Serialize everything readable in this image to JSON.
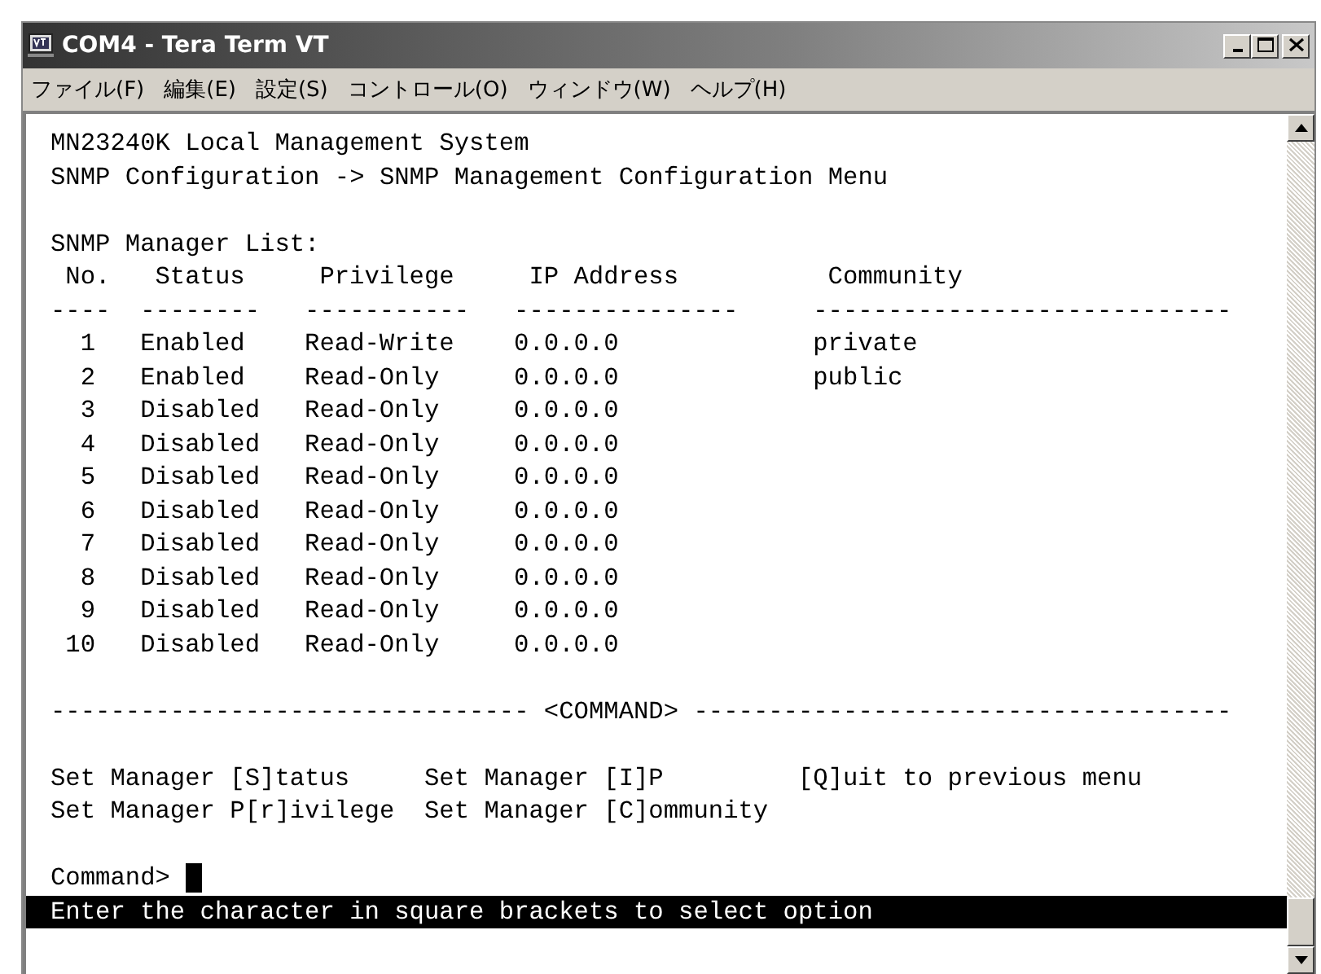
{
  "window": {
    "title": "COM4 - Tera Term VT"
  },
  "menu": [
    "ファイル(F)",
    "編集(E)",
    "設定(S)",
    "コントロール(O)",
    "ウィンドウ(W)",
    "ヘルプ(H)"
  ],
  "terminal": {
    "header_lines": [
      "MN23240K Local Management System",
      "SNMP Configuration -> SNMP Management Configuration Menu"
    ],
    "list_title": "SNMP Manager List:",
    "columns": [
      {
        "label": "No.",
        "rule": "----"
      },
      {
        "label": "Status",
        "rule": "--------"
      },
      {
        "label": "Privilege",
        "rule": "-----------"
      },
      {
        "label": "IP Address",
        "rule": "---------------"
      },
      {
        "label": "Community",
        "rule": "----------------------------"
      }
    ],
    "rows": [
      {
        "no": "1",
        "status": "Enabled",
        "privilege": "Read-Write",
        "ip": "0.0.0.0",
        "community": "private"
      },
      {
        "no": "2",
        "status": "Enabled",
        "privilege": "Read-Only",
        "ip": "0.0.0.0",
        "community": "public"
      },
      {
        "no": "3",
        "status": "Disabled",
        "privilege": "Read-Only",
        "ip": "0.0.0.0"
      },
      {
        "no": "4",
        "status": "Disabled",
        "privilege": "Read-Only",
        "ip": "0.0.0.0"
      },
      {
        "no": "5",
        "status": "Disabled",
        "privilege": "Read-Only",
        "ip": "0.0.0.0"
      },
      {
        "no": "6",
        "status": "Disabled",
        "privilege": "Read-Only",
        "ip": "0.0.0.0"
      },
      {
        "no": "7",
        "status": "Disabled",
        "privilege": "Read-Only",
        "ip": "0.0.0.0"
      },
      {
        "no": "8",
        "status": "Disabled",
        "privilege": "Read-Only",
        "ip": "0.0.0.0"
      },
      {
        "no": "9",
        "status": "Disabled",
        "privilege": "Read-Only",
        "ip": "0.0.0.0"
      },
      {
        "no": "10",
        "status": "Disabled",
        "privilege": "Read-Only",
        "ip": "0.0.0.0"
      }
    ],
    "command_rule": "-------------------------------- <COMMAND> ------------------------------------",
    "commands": [
      [
        "Set Manager [S]tatus",
        "Set Manager [I]P",
        "[Q]uit to previous menu"
      ],
      [
        "Set Manager P[r]ivilege",
        "Set Manager [C]ommunity"
      ]
    ],
    "prompt": "Command>",
    "status_line": "Enter the character in square brackets to select option"
  }
}
